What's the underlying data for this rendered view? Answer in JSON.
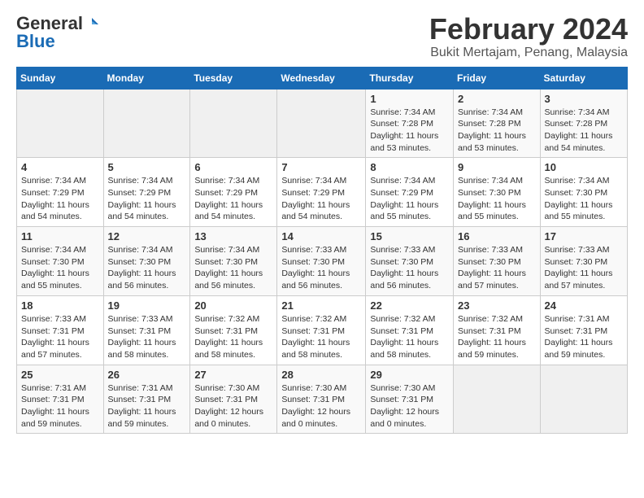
{
  "header": {
    "logo_general": "General",
    "logo_blue": "Blue",
    "month_title": "February 2024",
    "location": "Bukit Mertajam, Penang, Malaysia"
  },
  "days_of_week": [
    "Sunday",
    "Monday",
    "Tuesday",
    "Wednesday",
    "Thursday",
    "Friday",
    "Saturday"
  ],
  "weeks": [
    [
      {
        "day": "",
        "info": ""
      },
      {
        "day": "",
        "info": ""
      },
      {
        "day": "",
        "info": ""
      },
      {
        "day": "",
        "info": ""
      },
      {
        "day": "1",
        "info": "Sunrise: 7:34 AM\nSunset: 7:28 PM\nDaylight: 11 hours\nand 53 minutes."
      },
      {
        "day": "2",
        "info": "Sunrise: 7:34 AM\nSunset: 7:28 PM\nDaylight: 11 hours\nand 53 minutes."
      },
      {
        "day": "3",
        "info": "Sunrise: 7:34 AM\nSunset: 7:28 PM\nDaylight: 11 hours\nand 54 minutes."
      }
    ],
    [
      {
        "day": "4",
        "info": "Sunrise: 7:34 AM\nSunset: 7:29 PM\nDaylight: 11 hours\nand 54 minutes."
      },
      {
        "day": "5",
        "info": "Sunrise: 7:34 AM\nSunset: 7:29 PM\nDaylight: 11 hours\nand 54 minutes."
      },
      {
        "day": "6",
        "info": "Sunrise: 7:34 AM\nSunset: 7:29 PM\nDaylight: 11 hours\nand 54 minutes."
      },
      {
        "day": "7",
        "info": "Sunrise: 7:34 AM\nSunset: 7:29 PM\nDaylight: 11 hours\nand 54 minutes."
      },
      {
        "day": "8",
        "info": "Sunrise: 7:34 AM\nSunset: 7:29 PM\nDaylight: 11 hours\nand 55 minutes."
      },
      {
        "day": "9",
        "info": "Sunrise: 7:34 AM\nSunset: 7:30 PM\nDaylight: 11 hours\nand 55 minutes."
      },
      {
        "day": "10",
        "info": "Sunrise: 7:34 AM\nSunset: 7:30 PM\nDaylight: 11 hours\nand 55 minutes."
      }
    ],
    [
      {
        "day": "11",
        "info": "Sunrise: 7:34 AM\nSunset: 7:30 PM\nDaylight: 11 hours\nand 55 minutes."
      },
      {
        "day": "12",
        "info": "Sunrise: 7:34 AM\nSunset: 7:30 PM\nDaylight: 11 hours\nand 56 minutes."
      },
      {
        "day": "13",
        "info": "Sunrise: 7:34 AM\nSunset: 7:30 PM\nDaylight: 11 hours\nand 56 minutes."
      },
      {
        "day": "14",
        "info": "Sunrise: 7:33 AM\nSunset: 7:30 PM\nDaylight: 11 hours\nand 56 minutes."
      },
      {
        "day": "15",
        "info": "Sunrise: 7:33 AM\nSunset: 7:30 PM\nDaylight: 11 hours\nand 56 minutes."
      },
      {
        "day": "16",
        "info": "Sunrise: 7:33 AM\nSunset: 7:30 PM\nDaylight: 11 hours\nand 57 minutes."
      },
      {
        "day": "17",
        "info": "Sunrise: 7:33 AM\nSunset: 7:30 PM\nDaylight: 11 hours\nand 57 minutes."
      }
    ],
    [
      {
        "day": "18",
        "info": "Sunrise: 7:33 AM\nSunset: 7:31 PM\nDaylight: 11 hours\nand 57 minutes."
      },
      {
        "day": "19",
        "info": "Sunrise: 7:33 AM\nSunset: 7:31 PM\nDaylight: 11 hours\nand 58 minutes."
      },
      {
        "day": "20",
        "info": "Sunrise: 7:32 AM\nSunset: 7:31 PM\nDaylight: 11 hours\nand 58 minutes."
      },
      {
        "day": "21",
        "info": "Sunrise: 7:32 AM\nSunset: 7:31 PM\nDaylight: 11 hours\nand 58 minutes."
      },
      {
        "day": "22",
        "info": "Sunrise: 7:32 AM\nSunset: 7:31 PM\nDaylight: 11 hours\nand 58 minutes."
      },
      {
        "day": "23",
        "info": "Sunrise: 7:32 AM\nSunset: 7:31 PM\nDaylight: 11 hours\nand 59 minutes."
      },
      {
        "day": "24",
        "info": "Sunrise: 7:31 AM\nSunset: 7:31 PM\nDaylight: 11 hours\nand 59 minutes."
      }
    ],
    [
      {
        "day": "25",
        "info": "Sunrise: 7:31 AM\nSunset: 7:31 PM\nDaylight: 11 hours\nand 59 minutes."
      },
      {
        "day": "26",
        "info": "Sunrise: 7:31 AM\nSunset: 7:31 PM\nDaylight: 11 hours\nand 59 minutes."
      },
      {
        "day": "27",
        "info": "Sunrise: 7:30 AM\nSunset: 7:31 PM\nDaylight: 12 hours\nand 0 minutes."
      },
      {
        "day": "28",
        "info": "Sunrise: 7:30 AM\nSunset: 7:31 PM\nDaylight: 12 hours\nand 0 minutes."
      },
      {
        "day": "29",
        "info": "Sunrise: 7:30 AM\nSunset: 7:31 PM\nDaylight: 12 hours\nand 0 minutes."
      },
      {
        "day": "",
        "info": ""
      },
      {
        "day": "",
        "info": ""
      }
    ]
  ]
}
